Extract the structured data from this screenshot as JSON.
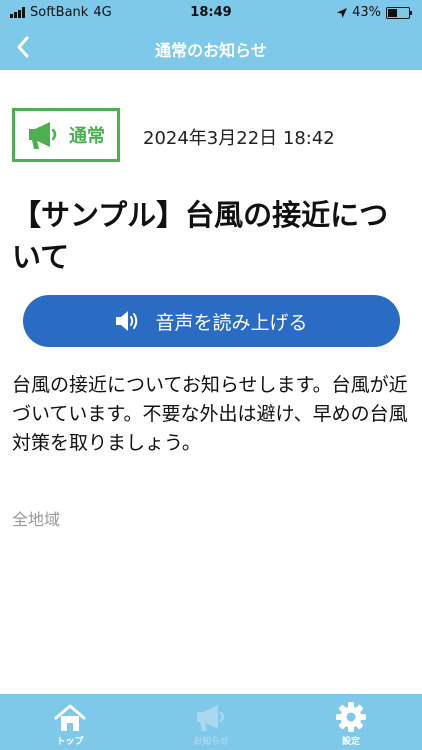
{
  "status_bar": {
    "carrier": "SoftBank",
    "network": "4G",
    "time": "18:49",
    "battery": "43%",
    "battery_level": 0.43
  },
  "nav": {
    "title": "通常のお知らせ",
    "back_icon": "chevron-left-icon"
  },
  "notice": {
    "badge_label": "通常",
    "badge_icon": "megaphone-icon",
    "badge_color": "#4caf50",
    "date": "2024年3月22日 18:42",
    "title": "【サンプル】台風の接近について",
    "tts_button_label": "音声を読み上げる",
    "tts_button_color": "#2a6bc4",
    "body": "台風の接近についてお知らせします。台風が近づいています。不要な外出は避け、早めの台風対策を取りましょう。",
    "region": "全地域"
  },
  "tabs": [
    {
      "label": "トップ",
      "icon": "home-icon",
      "active": true
    },
    {
      "label": "お知らせ",
      "icon": "megaphone-icon",
      "active": false
    },
    {
      "label": "設定",
      "icon": "gear-icon",
      "active": true
    }
  ],
  "colors": {
    "header": "#7ec8ea",
    "accent_blue": "#2a6bc4",
    "badge_green": "#4caf50"
  }
}
